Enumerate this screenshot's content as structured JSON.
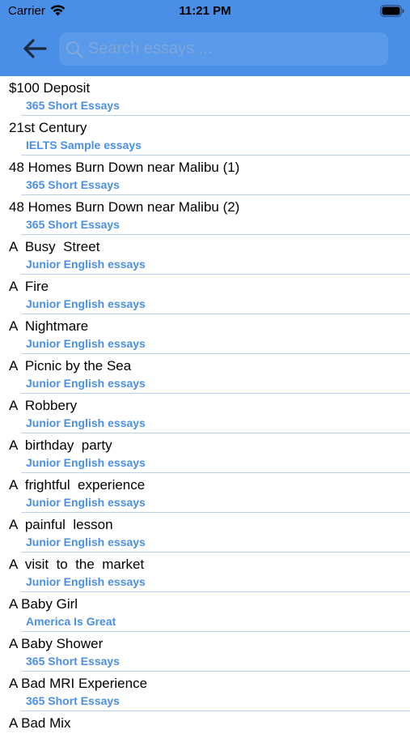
{
  "status_bar": {
    "carrier": "Carrier",
    "time": "11:21 PM",
    "icons": [
      "wifi-icon",
      "battery-icon"
    ]
  },
  "header": {
    "back_icon": "arrow-left-icon",
    "search": {
      "placeholder": "Search essays ...",
      "value": "",
      "icon": "search-icon"
    }
  },
  "colors": {
    "header_bg": "#4a8fe7",
    "subtitle": "#4a8fe7",
    "divider": "#b9d2f0"
  },
  "essays": [
    {
      "title": "$100 Deposit",
      "category": "365 Short Essays"
    },
    {
      "title": "21st Century",
      "category": "IELTS Sample essays"
    },
    {
      "title": "48 Homes Burn Down near Malibu (1)",
      "category": "365 Short Essays"
    },
    {
      "title": "48 Homes Burn Down near Malibu (2)",
      "category": "365 Short Essays"
    },
    {
      "title": "A  Busy  Street",
      "category": "Junior English essays"
    },
    {
      "title": "A  Fire",
      "category": "Junior English essays"
    },
    {
      "title": "A  Nightmare",
      "category": "Junior English essays"
    },
    {
      "title": "A  Picnic by the Sea",
      "category": "Junior English essays"
    },
    {
      "title": "A  Robbery",
      "category": "Junior English essays"
    },
    {
      "title": "A  birthday  party",
      "category": "Junior English essays"
    },
    {
      "title": "A  frightful  experience",
      "category": "Junior English essays"
    },
    {
      "title": "A  painful  lesson",
      "category": "Junior English essays"
    },
    {
      "title": "A  visit  to  the  market",
      "category": "Junior English essays"
    },
    {
      "title": "A Baby Girl",
      "category": "America Is Great"
    },
    {
      "title": "A Baby Shower",
      "category": "365 Short Essays"
    },
    {
      "title": "A Bad MRI Experience",
      "category": "365 Short Essays"
    },
    {
      "title": "A Bad Mix",
      "category": ""
    }
  ]
}
